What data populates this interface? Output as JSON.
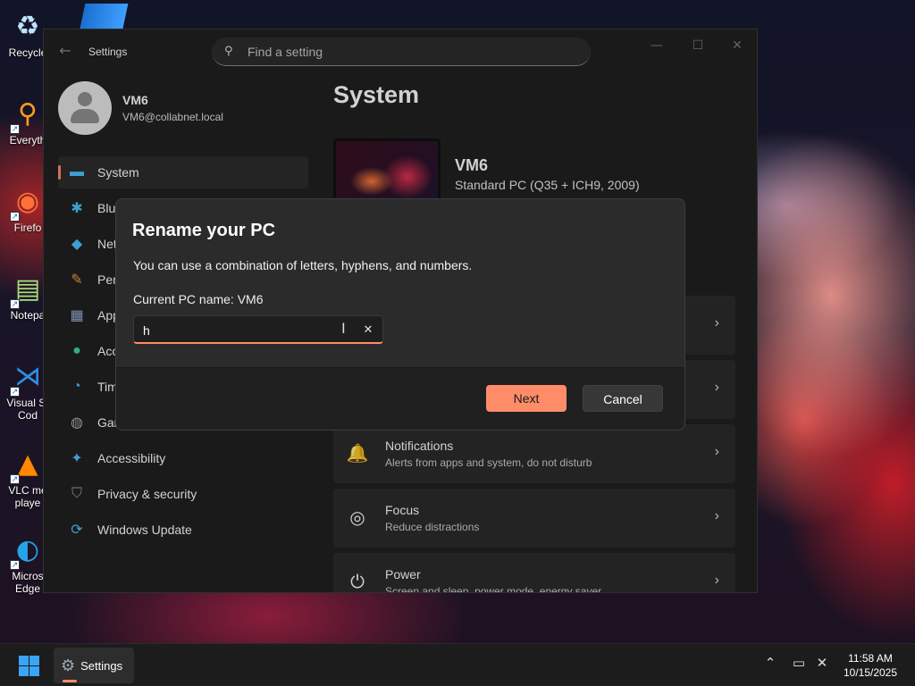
{
  "desktop": {
    "icons": [
      {
        "label": "Recycle",
        "glyph": "♻",
        "color": "#bfe3ff"
      },
      {
        "label": "Everyth",
        "glyph": "⚲",
        "color": "#ff9a1f"
      },
      {
        "label": "Firefo",
        "glyph": "◉",
        "color": "#ff7139"
      },
      {
        "label": "Notepa",
        "glyph": "▤",
        "color": "#a8e07a"
      },
      {
        "label": "Visual St Cod",
        "glyph": "⋊",
        "color": "#2f8fe6"
      },
      {
        "label": "VLC me playe",
        "glyph": "▲",
        "color": "#ff8800"
      },
      {
        "label": "Micros Edge",
        "glyph": "◐",
        "color": "#27a4e8"
      }
    ]
  },
  "window": {
    "title": "Settings",
    "search_placeholder": "Find a setting",
    "controls": {
      "minimize": "—",
      "maximize": "☐",
      "close": "✕"
    }
  },
  "profile": {
    "name": "VM6",
    "email": "VM6@collabnet.local"
  },
  "nav": [
    {
      "label": "System",
      "icon": "▬",
      "icon_color": "#4cc2ff",
      "active": true
    },
    {
      "label": "Blu",
      "icon": "✱",
      "icon_color": "#4cc2ff",
      "active": false
    },
    {
      "label": "Net",
      "icon": "◆",
      "icon_color": "#4cc2ff",
      "active": false
    },
    {
      "label": "Per",
      "icon": "✎",
      "icon_color": "#f0a040",
      "active": false
    },
    {
      "label": "App",
      "icon": "▦",
      "icon_color": "#9ab4d8",
      "active": false
    },
    {
      "label": "Acc",
      "icon": "●",
      "icon_color": "#3ad5b0",
      "active": false
    },
    {
      "label": "Tim",
      "icon": "◔",
      "icon_color": "#4cc2ff",
      "active": false
    },
    {
      "label": "Gar",
      "icon": "◍",
      "icon_color": "#b0b0b0",
      "active": false
    },
    {
      "label": "Accessibility",
      "icon": "✦",
      "icon_color": "#4cc2ff",
      "active": false
    },
    {
      "label": "Privacy & security",
      "icon": "⛉",
      "icon_color": "#9a9a9a",
      "active": false
    },
    {
      "label": "Windows Update",
      "icon": "⟳",
      "icon_color": "#4cc2ff",
      "active": false
    }
  ],
  "main": {
    "page_title": "System",
    "device": {
      "name": "VM6",
      "model": "Standard PC (Q35 + ICH9, 2009)"
    },
    "rows": [
      {
        "title": "",
        "desc": "",
        "icon": ""
      },
      {
        "title": "",
        "desc": "",
        "icon": ""
      },
      {
        "title": "Notifications",
        "desc": "Alerts from apps and system, do not disturb",
        "icon": "🔔"
      },
      {
        "title": "Focus",
        "desc": "Reduce distractions",
        "icon": "◎"
      },
      {
        "title": "Power",
        "desc": "Screen and sleep, power mode, energy saver",
        "icon": "⏻"
      }
    ]
  },
  "dialog": {
    "title": "Rename your PC",
    "description": "You can use a combination of letters, hyphens, and numbers.",
    "current_name": "Current PC name: VM6",
    "input_value": "h",
    "clear_icon": "✕",
    "next_label": "Next",
    "cancel_label": "Cancel"
  },
  "taskbar": {
    "app_label": "Settings",
    "time": "11:58 AM",
    "date": "10/15/2025"
  },
  "colors": {
    "accent": "#ff8c69",
    "start_blue": "#3aa5f5"
  }
}
